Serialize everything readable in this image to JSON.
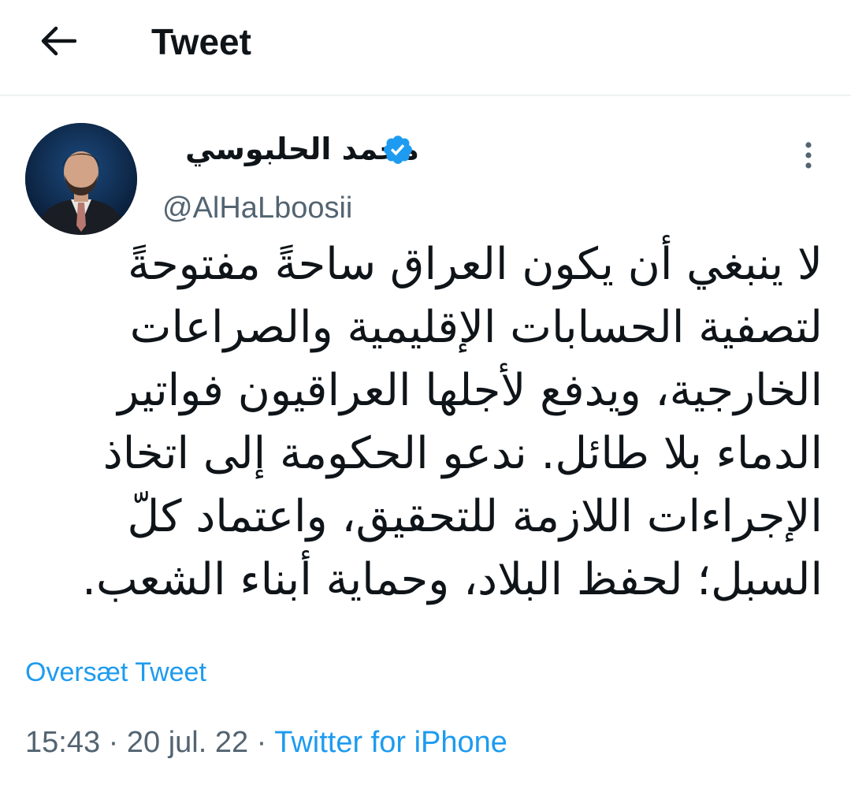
{
  "header": {
    "title": "Tweet",
    "back_icon": "arrow-left-icon"
  },
  "author": {
    "display_name": "محمد الحلبوسي",
    "handle": "@AlHaLboosii",
    "verified": true,
    "verified_color": "#1d9bf0"
  },
  "tweet": {
    "lines": [
      "لا ينبغي أن يكون العراق ساحةً مفتوحةً",
      "لتصفية الحسابات الإقليمية والصراعات",
      "الخارجية، ويدفع لأجلها العراقيون فواتير",
      "الدماء بلا طائل. ندعو الحكومة إلى اتخاذ",
      "الإجراءات اللازمة للتحقيق، واعتماد كلّ",
      "السبل؛ لحفظ البلاد، وحماية أبناء الشعب."
    ],
    "translate_label": "Oversæt Tweet",
    "time": "15:43",
    "date": "20 jul. 22",
    "separator": "·",
    "source": "Twitter for iPhone"
  },
  "colors": {
    "accent": "#1d9bf0",
    "secondary_text": "#536471",
    "divider": "#eff3f4"
  }
}
